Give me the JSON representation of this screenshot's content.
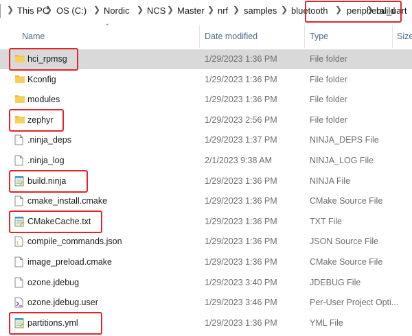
{
  "breadcrumbs": [
    "This PC",
    "OS (C:)",
    "Nordic",
    "NCS",
    "Master",
    "nrf",
    "samples",
    "bluetooth",
    "peripheral_uart",
    "build"
  ],
  "columns": {
    "name": "Name",
    "date": "Date modified",
    "type": "Type",
    "size": "Size"
  },
  "files": [
    {
      "name": "hci_rpmsg",
      "date": "1/29/2023 1:36 PM",
      "type": "File folder",
      "icon": "folder-icon",
      "selected": true,
      "highlighted": true
    },
    {
      "name": "Kconfig",
      "date": "1/29/2023 1:36 PM",
      "type": "File folder",
      "icon": "folder-icon"
    },
    {
      "name": "modules",
      "date": "1/29/2023 1:36 PM",
      "type": "File folder",
      "icon": "folder-icon"
    },
    {
      "name": "zephyr",
      "date": "1/29/2023 2:56 PM",
      "type": "File folder",
      "icon": "folder-icon",
      "highlighted": true
    },
    {
      "name": ".ninja_deps",
      "date": "1/29/2023 1:37 PM",
      "type": "NINJA_DEPS File",
      "icon": "file-icon"
    },
    {
      "name": ".ninja_log",
      "date": "2/1/2023 9:38 AM",
      "type": "NINJA_LOG File",
      "icon": "file-icon"
    },
    {
      "name": "build.ninja",
      "date": "1/29/2023 1:36 PM",
      "type": "NINJA File",
      "icon": "notepad-icon",
      "highlighted": true
    },
    {
      "name": "cmake_install.cmake",
      "date": "1/29/2023 1:36 PM",
      "type": "CMake Source File",
      "icon": "file-icon"
    },
    {
      "name": "CMakeCache.txt",
      "date": "1/29/2023 1:36 PM",
      "type": "TXT File",
      "icon": "notepad-icon",
      "highlighted": true
    },
    {
      "name": "compile_commands.json",
      "date": "1/29/2023 1:36 PM",
      "type": "JSON Source File",
      "icon": "json-file-icon"
    },
    {
      "name": "image_preload.cmake",
      "date": "1/29/2023 1:36 PM",
      "type": "CMake Source File",
      "icon": "file-icon"
    },
    {
      "name": "ozone.jdebug",
      "date": "1/29/2023 3:40 PM",
      "type": "JDEBUG File",
      "icon": "file-icon"
    },
    {
      "name": "ozone.jdebug.user",
      "date": "1/29/2023 3:46 PM",
      "type": "Per-User Project Opti...",
      "icon": "vs-user-file-icon"
    },
    {
      "name": "partitions.yml",
      "date": "1/29/2023 1:36 PM",
      "type": "YML File",
      "icon": "notepad-icon",
      "highlighted": true
    }
  ],
  "colors": {
    "highlight": "#e0242a",
    "selected_row": "#d9d9d9",
    "folder": "#f5c342"
  }
}
